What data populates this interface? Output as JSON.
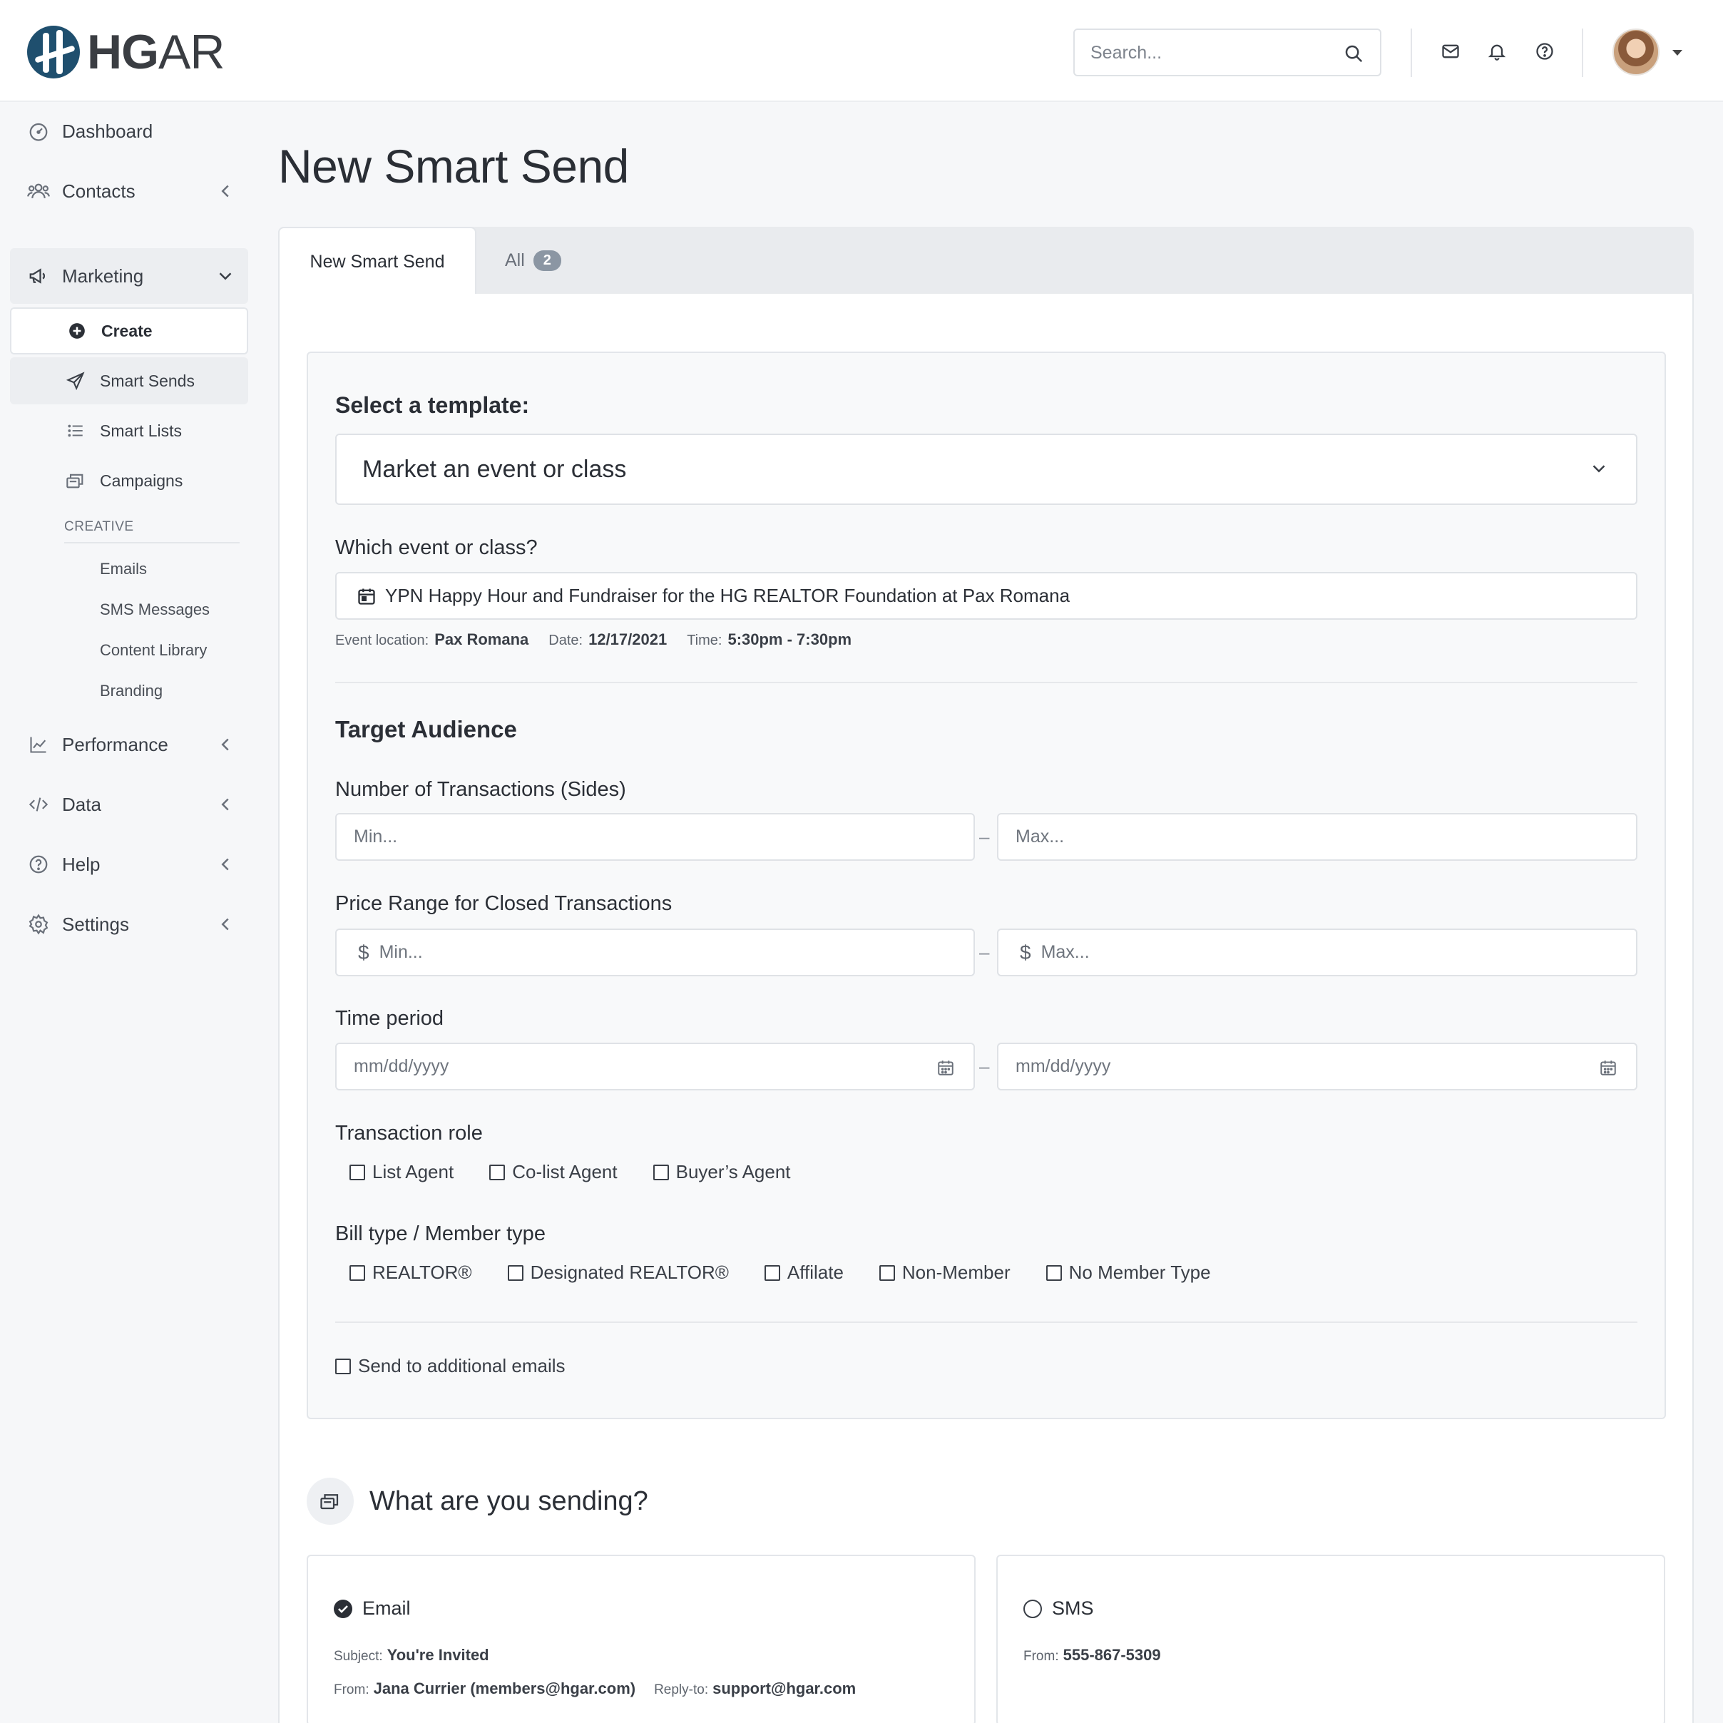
{
  "header": {
    "logo_text_bold": "HG",
    "logo_text_light": "AR",
    "search_placeholder": "Search..."
  },
  "sidebar": {
    "items": [
      {
        "label": "Dashboard"
      },
      {
        "label": "Contacts"
      },
      {
        "label": "Marketing"
      },
      {
        "label": "Performance"
      },
      {
        "label": "Data"
      },
      {
        "label": "Help"
      },
      {
        "label": "Settings"
      }
    ],
    "marketing_sub": [
      {
        "label": "Create"
      },
      {
        "label": "Smart Sends"
      },
      {
        "label": "Smart Lists"
      },
      {
        "label": "Campaigns"
      }
    ],
    "creative_header": "CREATIVE",
    "creative_items": [
      {
        "label": "Emails"
      },
      {
        "label": "SMS Messages"
      },
      {
        "label": "Content Library"
      },
      {
        "label": "Branding"
      }
    ]
  },
  "main": {
    "title": "New Smart Send",
    "tabs": [
      {
        "label": "New Smart Send"
      },
      {
        "label": "All",
        "badge": "2"
      }
    ]
  },
  "form": {
    "template_label": "Select a template:",
    "template_value": "Market an event or class",
    "event_label": "Which event or class?",
    "event_value": "YPN Happy Hour and Fundraiser for the HG REALTOR Foundation at Pax Romana",
    "event_meta": {
      "location_label": "Event location:",
      "location": "Pax Romana",
      "date_label": "Date:",
      "date": "12/17/2021",
      "time_label": "Time:",
      "time": "5:30pm - 7:30pm"
    },
    "audience_title": "Target Audience",
    "transactions_label": "Number of Transactions (Sides)",
    "min_placeholder": "Min...",
    "max_placeholder": "Max...",
    "price_label": "Price Range for Closed Transactions",
    "currency_symbol": "$",
    "time_period_label": "Time period",
    "date_placeholder": "mm/dd/yyyy",
    "range_separator": "–",
    "role_label": "Transaction role",
    "roles": [
      {
        "label": "List Agent"
      },
      {
        "label": "Co-list Agent"
      },
      {
        "label": "Buyer’s Agent"
      }
    ],
    "bill_label": "Bill type / Member type",
    "bill_types": [
      {
        "label": "REALTOR®"
      },
      {
        "label": "Designated REALTOR®"
      },
      {
        "label": "Affilate"
      },
      {
        "label": "Non-Member"
      },
      {
        "label": "No Member Type"
      }
    ],
    "additional_emails_label": "Send to additional emails"
  },
  "sending": {
    "title": "What are you sending?",
    "email": {
      "label": "Email",
      "selected": true,
      "subject_label": "Subject:",
      "subject": "You're Invited",
      "from_label": "From:",
      "from": "Jana Currier (members@hgar.com)",
      "reply_label": "Reply-to:",
      "reply": "support@hgar.com"
    },
    "sms": {
      "label": "SMS",
      "selected": false,
      "from_label": "From:",
      "from": "555-867-5309"
    }
  }
}
